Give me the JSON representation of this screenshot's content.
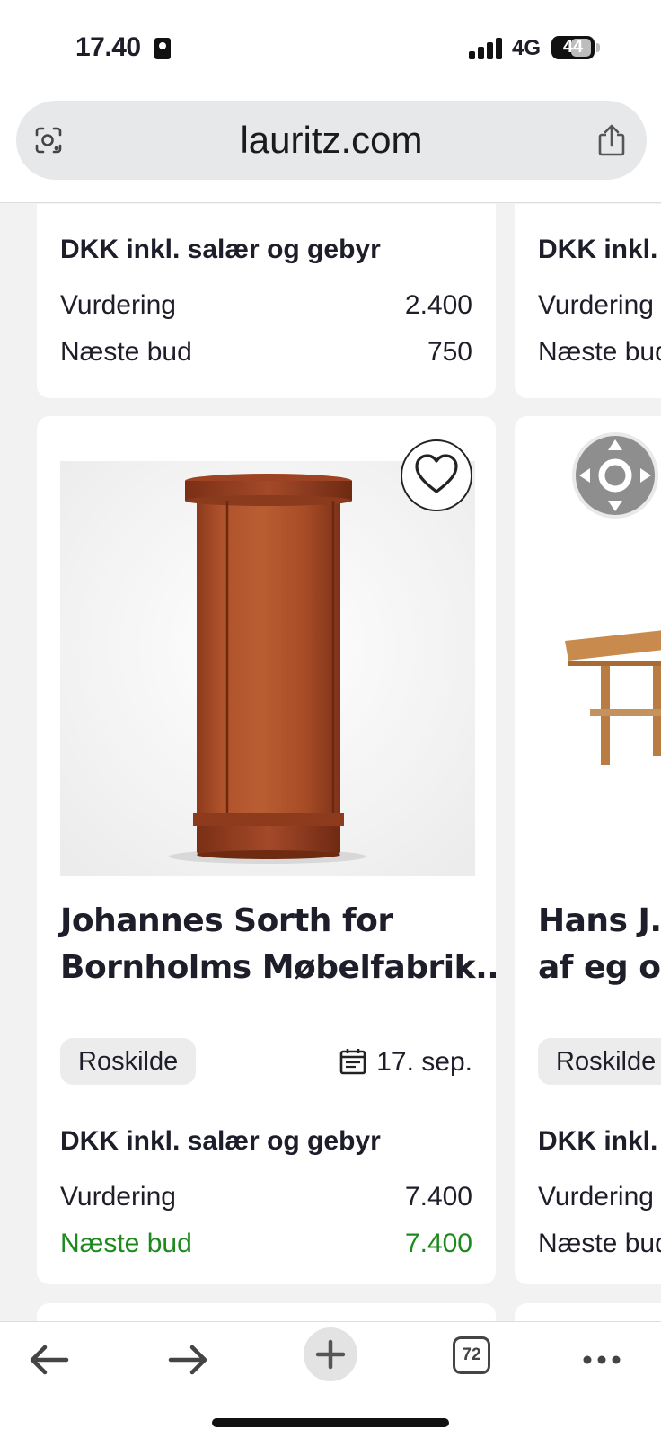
{
  "status_bar": {
    "time": "17.40",
    "network": "4G",
    "battery": "44"
  },
  "browser": {
    "url": "lauritz.com"
  },
  "cards": {
    "top_left": {
      "price_title": "DKK inkl. salær og gebyr",
      "valuation_label": "Vurdering",
      "valuation_value": "2.400",
      "next_bid_label": "Næste bud",
      "next_bid_value": "750"
    },
    "top_right": {
      "price_title": "DKK inkl.",
      "valuation_label": "Vurdering",
      "next_bid_label": "Næste bud"
    },
    "main_left": {
      "title_line1": "Johannes Sorth for",
      "title_line2": "Bornholms Møbelfabrik....",
      "location": "Roskilde",
      "date": "17. sep.",
      "price_title": "DKK inkl. salær og gebyr",
      "valuation_label": "Vurdering",
      "valuation_value": "7.400",
      "next_bid_label": "Næste bud",
      "next_bid_value": "7.400"
    },
    "main_right": {
      "title_line1": "Hans J. W",
      "title_line2": "af eg og",
      "location": "Roskilde",
      "price_title": "DKK inkl.",
      "valuation_label": "Vurdering",
      "next_bid_label": "Næste bud"
    }
  },
  "toolbar": {
    "tab_count": "72"
  },
  "colors": {
    "next_bid_highlight": "#1e8a1e",
    "background": "#f2f2f2"
  }
}
